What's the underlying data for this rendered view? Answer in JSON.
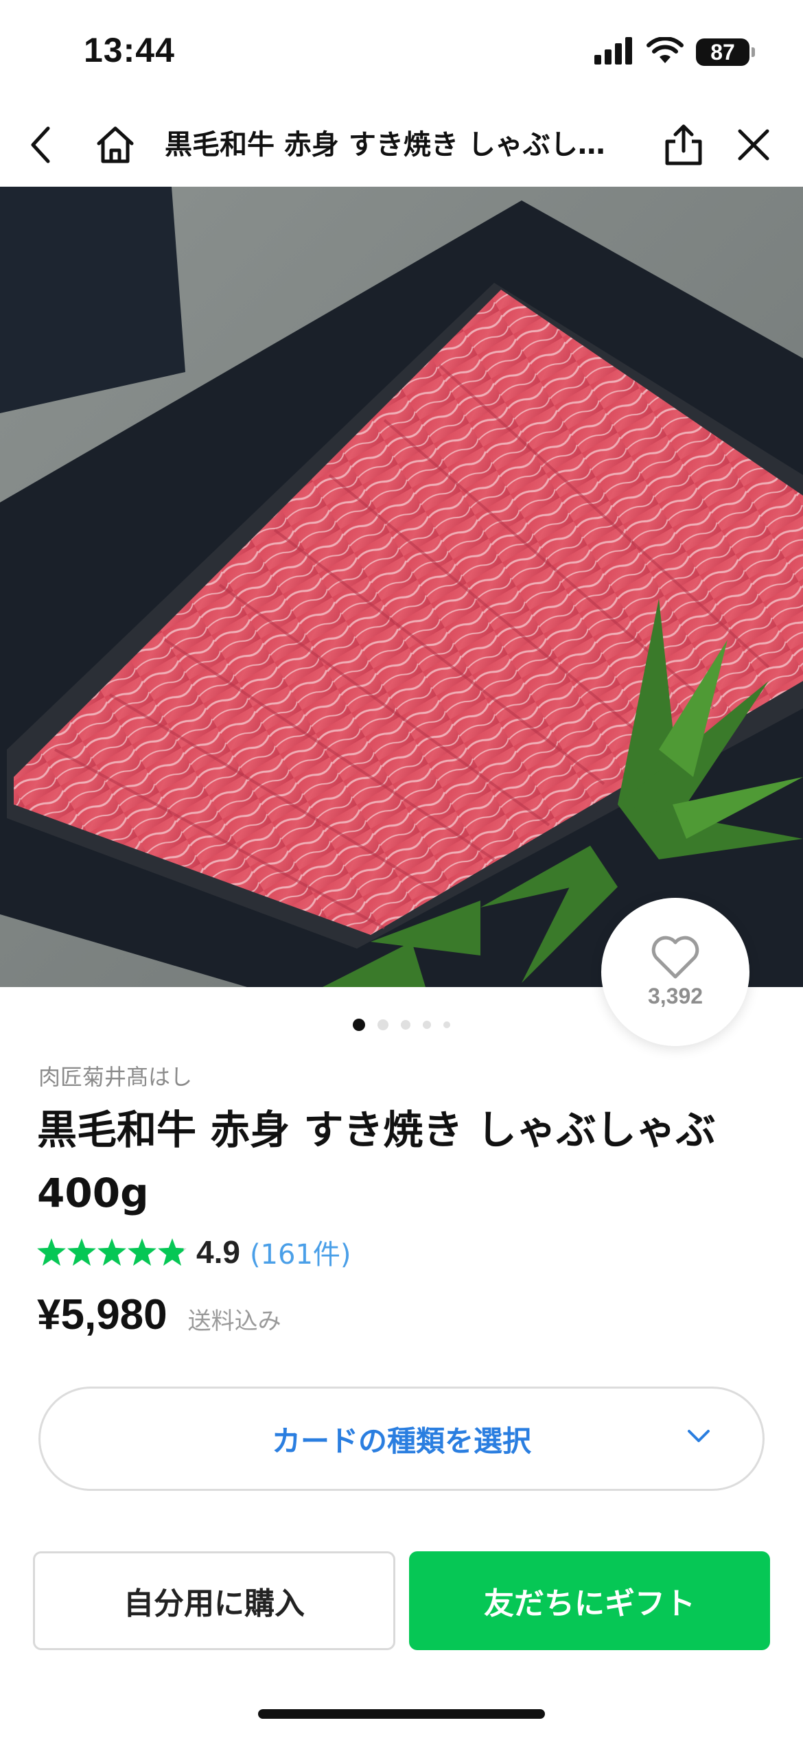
{
  "status_bar": {
    "time": "13:44",
    "battery": "87",
    "icons": [
      "signal-icon",
      "wifi-icon",
      "battery-icon"
    ]
  },
  "nav": {
    "title": "黒毛和牛 赤身 すき焼き しゃぶし…",
    "icons": [
      "back-icon",
      "home-icon",
      "share-icon",
      "close-icon"
    ]
  },
  "hero": {
    "like_count": "3,392",
    "pager": {
      "total": 5,
      "active": 1
    }
  },
  "product": {
    "shop_name": "肉匠菊井髙はし",
    "title": "黒毛和牛 赤身 すき焼き しゃぶしゃぶ 400g",
    "rating": {
      "stars": 4.9,
      "value": "4.9",
      "count_label": "(161件)"
    },
    "price": "¥5,980",
    "price_note": "送料込み"
  },
  "card_select": {
    "label": "カードの種類を選択"
  },
  "actions": {
    "buy_self_label": "自分用に購入",
    "gift_label": "友だちにギフト"
  },
  "colors": {
    "accent_green": "#06c755",
    "link_blue": "#2a7ee0",
    "star_green": "#06c755"
  }
}
